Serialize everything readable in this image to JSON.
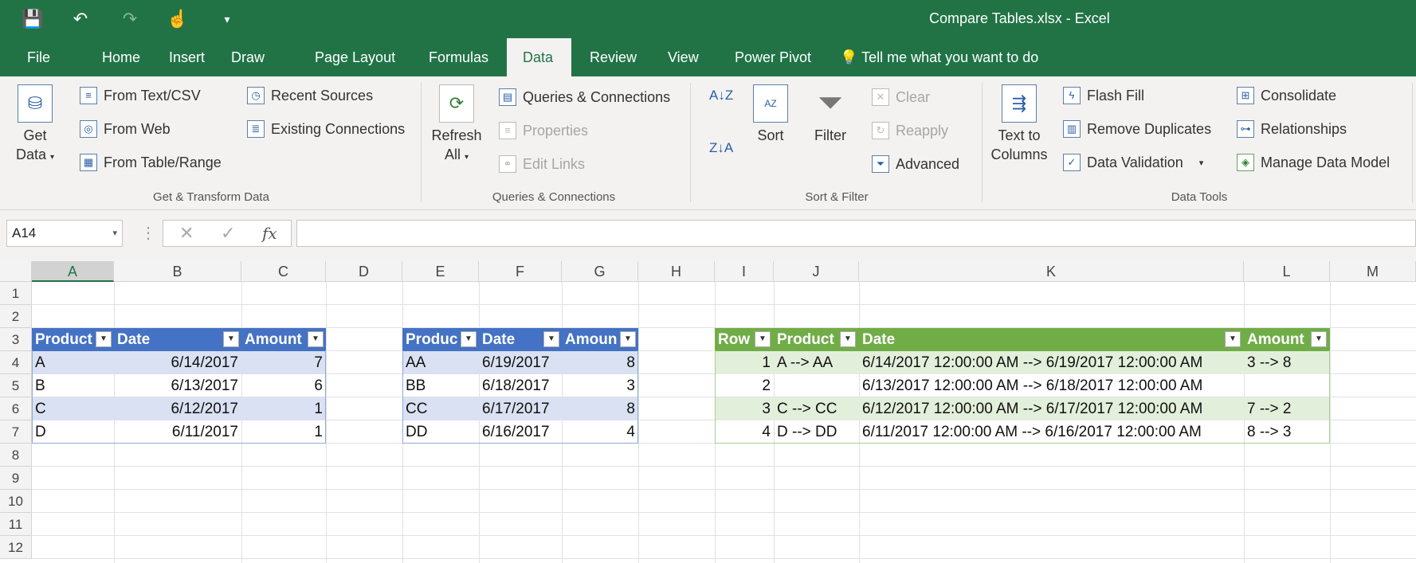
{
  "qat": {
    "save": "💾",
    "undo": "↶",
    "redo": "↷",
    "touch": "☝",
    "customize": "▾"
  },
  "title": "Compare Tables.xlsx  -  Excel",
  "tabs": [
    "File",
    "Home",
    "Insert",
    "Draw",
    "Page Layout",
    "Formulas",
    "Data",
    "Review",
    "View",
    "Power Pivot"
  ],
  "tell_me": "Tell me what you want to do",
  "ribbon": {
    "get_data": "Get",
    "get_data2": "Data",
    "from_text": "From Text/CSV",
    "from_web": "From Web",
    "from_table": "From Table/Range",
    "recent_sources": "Recent Sources",
    "existing_connections": "Existing Connections",
    "group1": "Get & Transform Data",
    "refresh": "Refresh",
    "refresh2": "All",
    "queries_connections": "Queries & Connections",
    "properties": "Properties",
    "edit_links": "Edit Links",
    "group2": "Queries & Connections",
    "sort": "Sort",
    "filter": "Filter",
    "clear": "Clear",
    "reapply": "Reapply",
    "advanced": "Advanced",
    "group3": "Sort & Filter",
    "text_to": "Text to",
    "columns": "Columns",
    "flash_fill": "Flash Fill",
    "remove_duplicates": "Remove Duplicates",
    "data_validation": "Data Validation",
    "consolidate": "Consolidate",
    "relationships": "Relationships",
    "manage_data_model": "Manage Data Model",
    "group4": "Data Tools"
  },
  "formula_bar": {
    "name_box": "A14",
    "formula": ""
  },
  "columns": [
    "A",
    "B",
    "C",
    "D",
    "E",
    "F",
    "G",
    "H",
    "I",
    "J",
    "K",
    "L",
    "M"
  ],
  "rows": [
    "1",
    "2",
    "3",
    "4",
    "5",
    "6",
    "7",
    "8",
    "9",
    "10",
    "11",
    "12"
  ],
  "table1": {
    "headers": [
      "Product",
      "Date",
      "Amount"
    ],
    "rows": [
      [
        "A",
        "6/14/2017",
        "7"
      ],
      [
        "B",
        "6/13/2017",
        "6"
      ],
      [
        "C",
        "6/12/2017",
        "1"
      ],
      [
        "D",
        "6/11/2017",
        "1"
      ]
    ]
  },
  "table2": {
    "headers": [
      "Produc",
      "Date",
      "Amoun"
    ],
    "rows": [
      [
        "AA",
        "6/19/2017",
        "8"
      ],
      [
        "BB",
        "6/18/2017",
        "3"
      ],
      [
        "CC",
        "6/17/2017",
        "8"
      ],
      [
        "DD",
        "6/16/2017",
        "4"
      ]
    ]
  },
  "table3": {
    "headers": [
      "Row",
      "Product",
      "Date",
      "Amount"
    ],
    "rows": [
      [
        "1",
        "A --> AA",
        "6/14/2017 12:00:00 AM --> 6/19/2017 12:00:00 AM",
        "3 --> 8"
      ],
      [
        "2",
        "",
        "6/13/2017 12:00:00 AM --> 6/18/2017 12:00:00 AM",
        ""
      ],
      [
        "3",
        "C --> CC",
        "6/12/2017 12:00:00 AM --> 6/17/2017 12:00:00 AM",
        "7 --> 2"
      ],
      [
        "4",
        "D --> DD",
        "6/11/2017 12:00:00 AM --> 6/16/2017 12:00:00 AM",
        "8 --> 3"
      ]
    ]
  },
  "colors": {
    "brand": "#217346",
    "table1_header": "#4472c4",
    "table1_band": "#d9e1f2",
    "table3_header": "#70ad47",
    "table3_band": "#e2efda"
  }
}
